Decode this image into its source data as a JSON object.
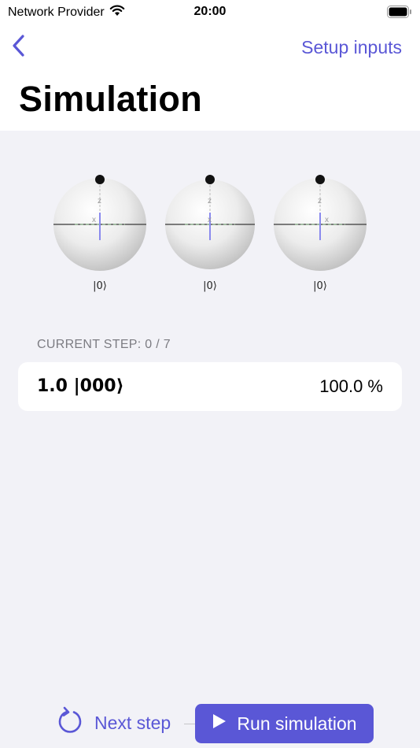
{
  "status_bar": {
    "carrier": "Network Provider",
    "time": "20:00",
    "wifi_icon": "wifi-icon",
    "battery_icon": "battery-icon"
  },
  "nav": {
    "back_icon": "chevron-left-icon",
    "setup_label": "Setup inputs",
    "title": "Simulation"
  },
  "qubits": [
    {
      "axis_z": "z",
      "axis_x": "x",
      "state_label": "|0⟩"
    },
    {
      "axis_z": "z",
      "axis_x": "x",
      "state_label": "|0⟩"
    },
    {
      "axis_z": "z",
      "axis_x": "x",
      "state_label": "|0⟩"
    }
  ],
  "current_step": {
    "header": "CURRENT STEP: 0 / 7"
  },
  "states": [
    {
      "amplitude_ket": "1.0 |000⟩",
      "probability": "100.0 %"
    }
  ],
  "toolbar": {
    "next_step_icon": "rotate-icon",
    "next_step_label": "Next step",
    "run_icon": "play-icon",
    "run_label": "Run simulation"
  },
  "colors": {
    "accent": "#5a57d6",
    "background": "#f2f2f7",
    "card": "#ffffff"
  }
}
